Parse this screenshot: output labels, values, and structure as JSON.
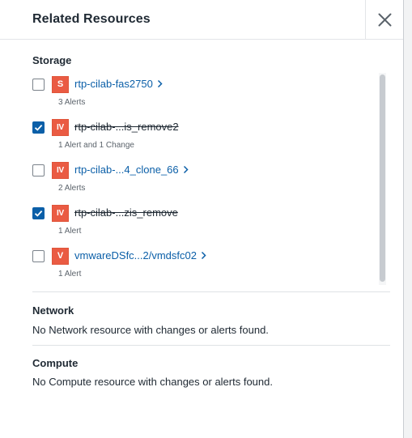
{
  "header": {
    "title": "Related Resources",
    "close_icon": "close-icon"
  },
  "storage": {
    "title": "Storage",
    "items": [
      {
        "checked": false,
        "badge": "S",
        "name": "rtp-cilab-fas2750",
        "struck": false,
        "sub": "3 Alerts"
      },
      {
        "checked": true,
        "badge": "IV",
        "name": "rtp-cilab-...is_remove2",
        "struck": true,
        "sub": "1 Alert and 1 Change"
      },
      {
        "checked": false,
        "badge": "IV",
        "name": "rtp-cilab-...4_clone_66",
        "struck": false,
        "sub": "2 Alerts"
      },
      {
        "checked": true,
        "badge": "IV",
        "name": "rtp-cilab-...zis_remove",
        "struck": true,
        "sub": "1 Alert"
      },
      {
        "checked": false,
        "badge": "V",
        "name": "vmwareDSfc...2/vmdsfc02",
        "struck": false,
        "sub": "1 Alert"
      }
    ]
  },
  "network": {
    "title": "Network",
    "message": "No Network resource with changes or alerts found."
  },
  "compute": {
    "title": "Compute",
    "message": "No Compute resource with changes or alerts found."
  },
  "colors": {
    "accent": "#0b5fa8",
    "badge": "#ea5b43"
  }
}
